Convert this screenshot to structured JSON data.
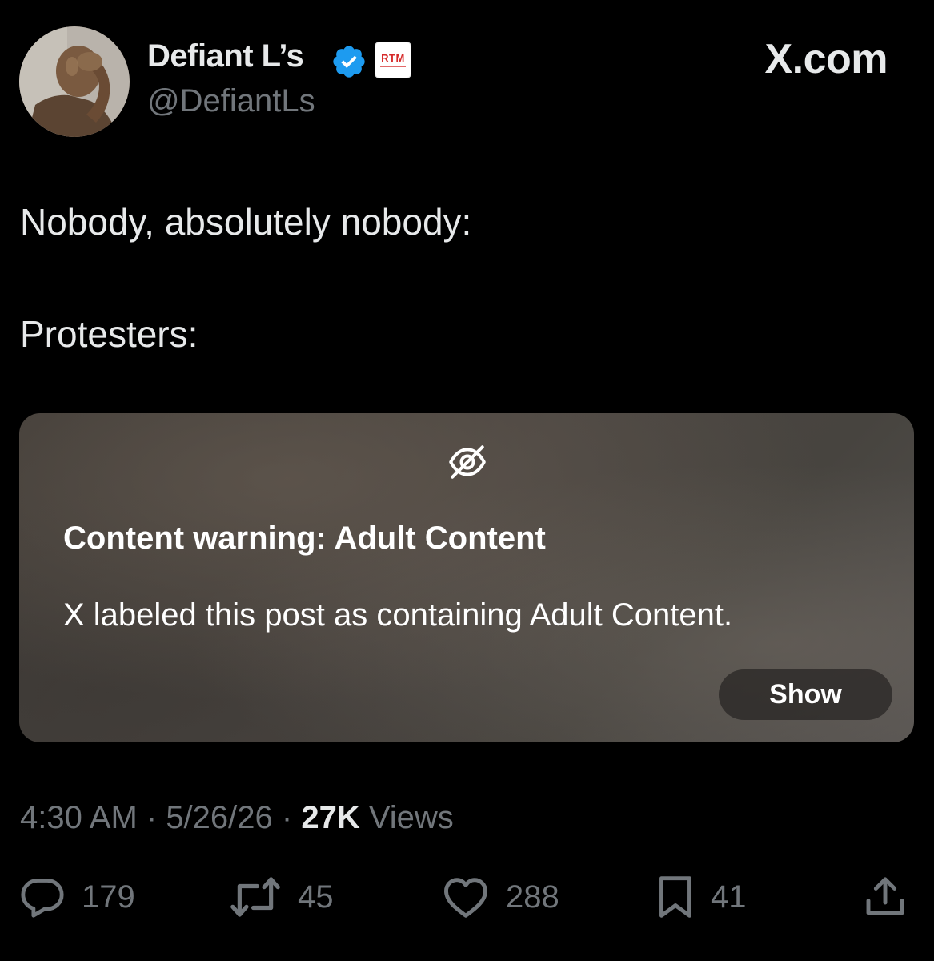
{
  "author": {
    "display_name": "Defiant L’s",
    "handle": "@DefiantLs",
    "affiliate_badge_text": "RTM"
  },
  "source_label": "X.com",
  "post": {
    "lines": [
      "Nobody, absolutely nobody:",
      "Protesters:"
    ]
  },
  "content_warning": {
    "title": "Content warning: Adult Content",
    "description": "X labeled this post as containing Adult Content.",
    "show_label": "Show"
  },
  "meta": {
    "time": "4:30 AM",
    "separator": " · ",
    "date": "5/26/26",
    "views_count": "27K",
    "views_label": " Views"
  },
  "actions": {
    "replies": "179",
    "reposts": "45",
    "likes": "288",
    "bookmarks": "41"
  },
  "colors": {
    "background": "#000000",
    "primary_text": "#e7e9ea",
    "secondary_text": "#71767b",
    "verified_blue": "#1d9bf0",
    "affiliate_red": "#d62a2a"
  },
  "icons": [
    "verified-badge-icon",
    "eye-slash-icon",
    "reply-icon",
    "repost-icon",
    "like-icon",
    "bookmark-icon",
    "share-icon"
  ]
}
